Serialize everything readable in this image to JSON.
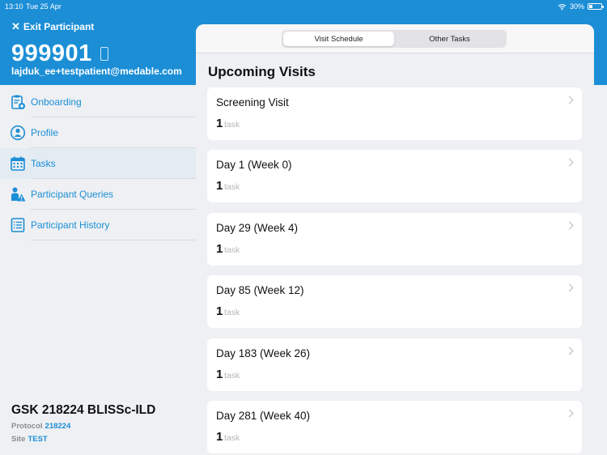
{
  "status_bar": {
    "time": "13:10",
    "date": "Tue 25 Apr",
    "battery": "30%"
  },
  "header": {
    "exit_label": "Exit Participant",
    "participant_id": "999901",
    "email": "lajduk_ee+testpatient@medable.com"
  },
  "sidebar": {
    "items": [
      {
        "label": "Onboarding",
        "icon": "clipboard-plus-icon"
      },
      {
        "label": "Profile",
        "icon": "person-circle-icon"
      },
      {
        "label": "Tasks",
        "icon": "calendar-icon",
        "active": true
      },
      {
        "label": "Participant Queries",
        "icon": "person-warning-icon"
      },
      {
        "label": "Participant History",
        "icon": "list-document-icon"
      }
    ],
    "study_name": "GSK 218224 BLISSc-ILD",
    "protocol_label": "Protocol",
    "protocol_value": "218224",
    "site_label": "Site",
    "site_value": "TEST"
  },
  "main": {
    "tabs": [
      {
        "label": "Visit Schedule",
        "selected": true
      },
      {
        "label": "Other Tasks",
        "selected": false
      }
    ],
    "section_title": "Upcoming Visits",
    "visits": [
      {
        "name": "Screening Visit",
        "count": "1",
        "unit": "task"
      },
      {
        "name": "Day 1 (Week 0)",
        "count": "1",
        "unit": "task"
      },
      {
        "name": "Day 29 (Week 4)",
        "count": "1",
        "unit": "task"
      },
      {
        "name": "Day 85 (Week 12)",
        "count": "1",
        "unit": "task"
      },
      {
        "name": "Day 183 (Week 26)",
        "count": "1",
        "unit": "task"
      },
      {
        "name": "Day 281 (Week 40)",
        "count": "1",
        "unit": "task"
      }
    ]
  },
  "colors": {
    "brand_blue": "#1b8ed6",
    "background": "#eef0f3",
    "card": "#ffffff"
  }
}
